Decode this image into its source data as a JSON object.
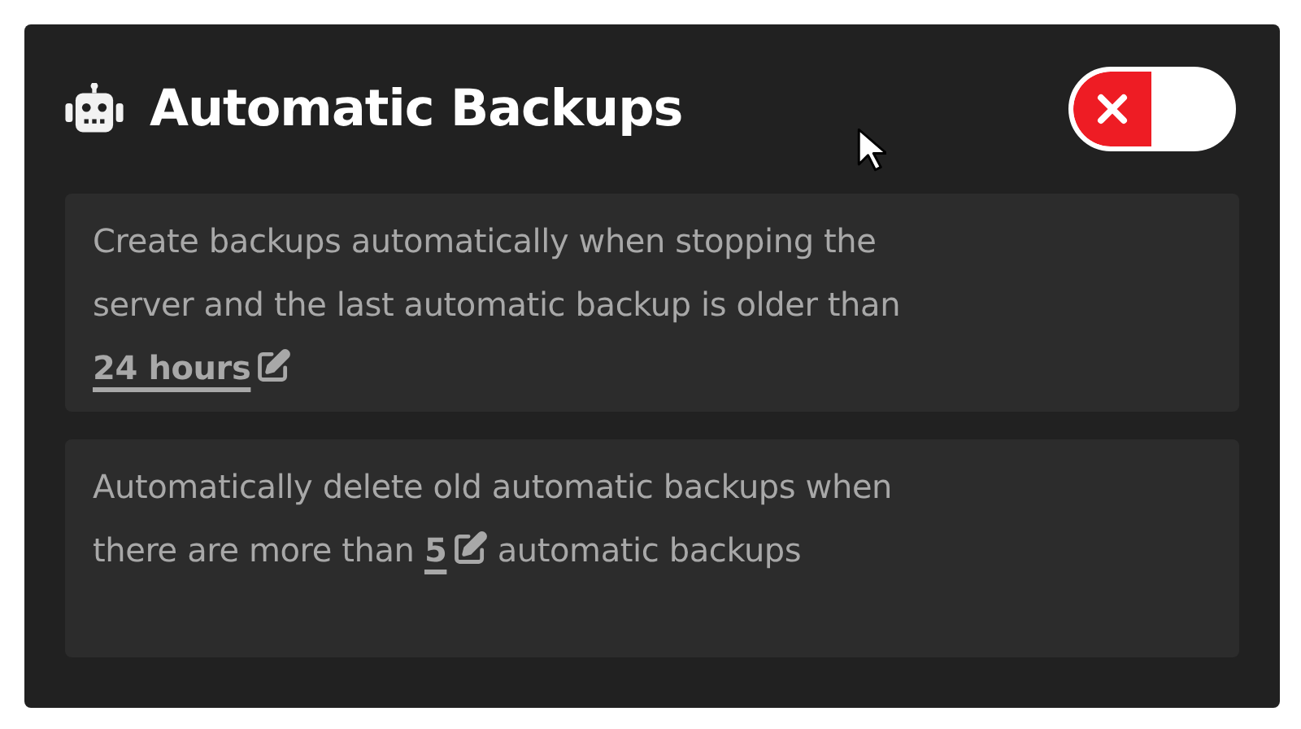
{
  "title": "Automatic Backups",
  "toggle": {
    "on": false
  },
  "settings": [
    {
      "before": "Create backups automatically when stopping the server and the last automatic backup is older than",
      "value": "24 hours"
    },
    {
      "before": "Automatically delete old automatic backups when there are more than",
      "value": "5",
      "after": "automatic backups"
    }
  ]
}
